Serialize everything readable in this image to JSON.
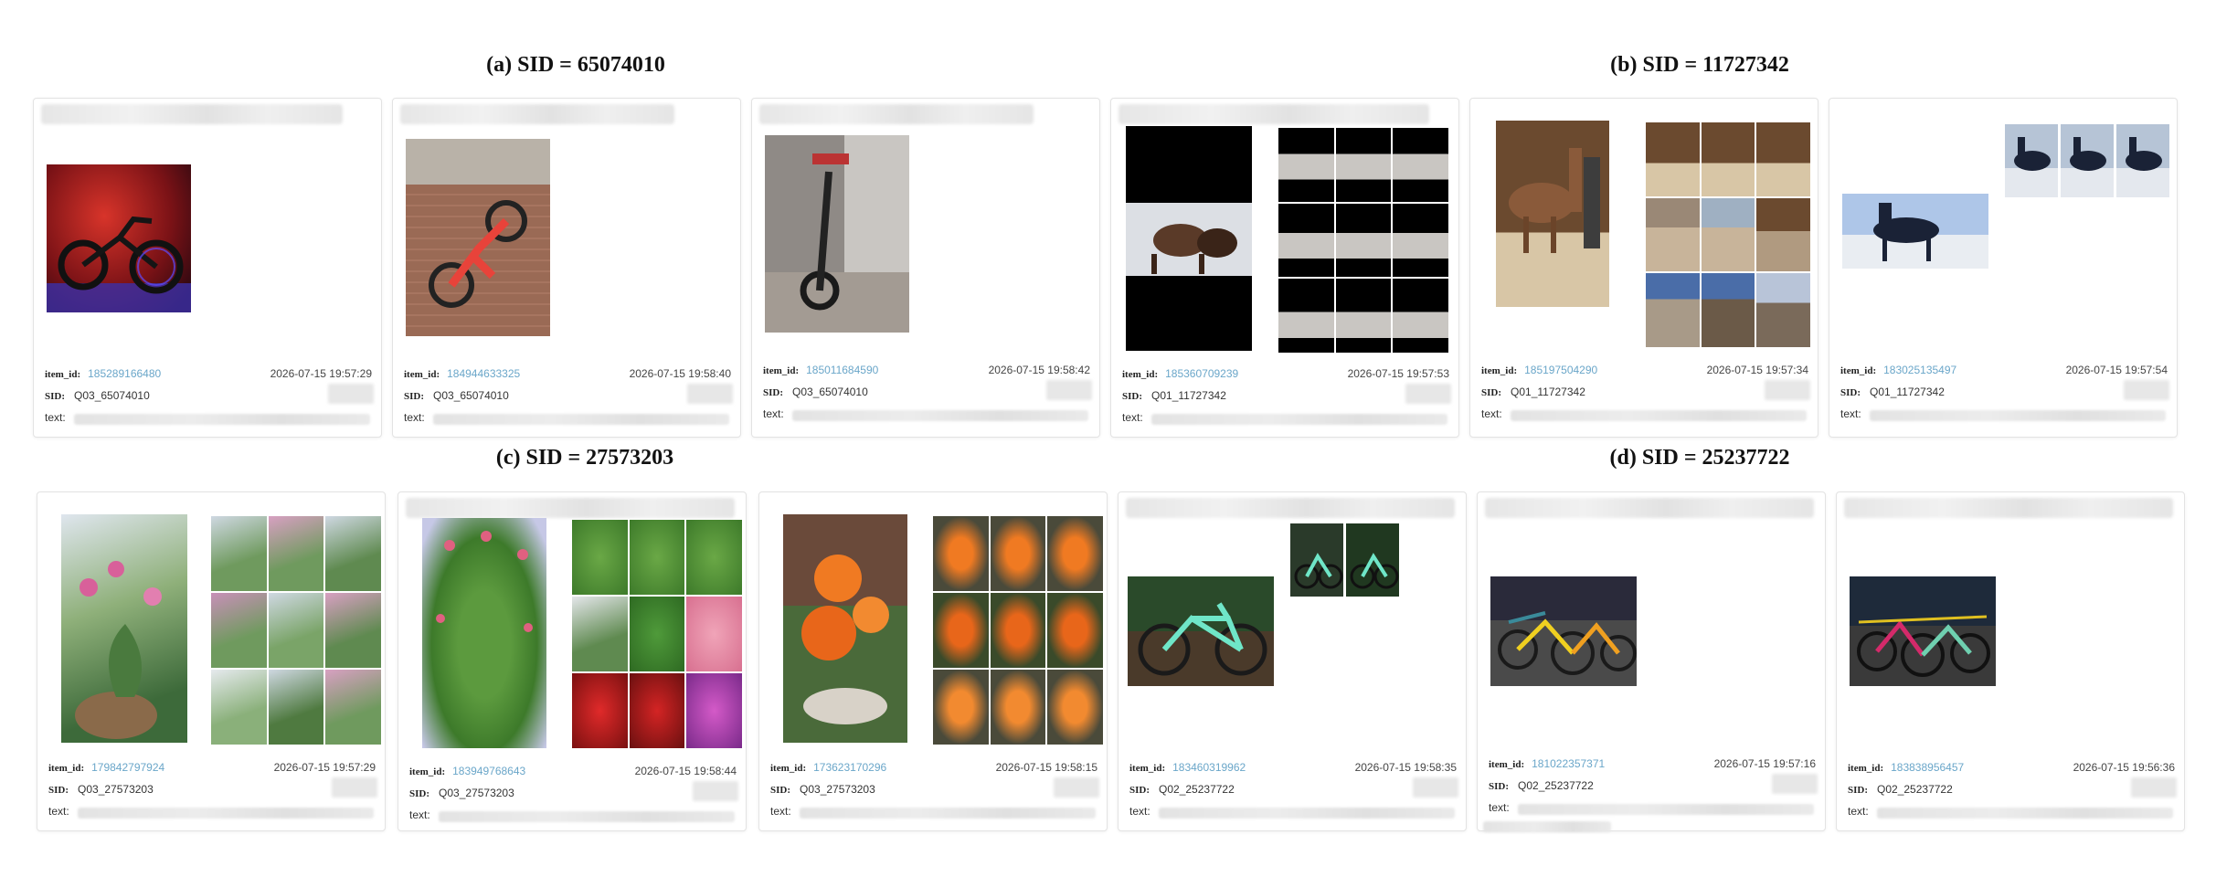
{
  "captions": {
    "a": "(a) SID = 65074010",
    "b": "(b) SID = 11727342",
    "c": "(c) SID = 27573203",
    "d": "(d) SID = 25237722"
  },
  "labels": {
    "item_id": "item_id:",
    "sid": "SID:",
    "text": "text:"
  },
  "cards": [
    {
      "item_id": "185289166480",
      "timestamp": "2026-07-15 19:57:29",
      "sid": "Q03_65074010"
    },
    {
      "item_id": "184944633325",
      "timestamp": "2026-07-15 19:58:40",
      "sid": "Q03_65074010"
    },
    {
      "item_id": "185011684590",
      "timestamp": "2026-07-15 19:58:42",
      "sid": "Q03_65074010"
    },
    {
      "item_id": "185360709239",
      "timestamp": "2026-07-15 19:57:53",
      "sid": "Q01_11727342"
    },
    {
      "item_id": "185197504290",
      "timestamp": "2026-07-15 19:57:34",
      "sid": "Q01_11727342"
    },
    {
      "item_id": "183025135497",
      "timestamp": "2026-07-15 19:57:54",
      "sid": "Q01_11727342"
    },
    {
      "item_id": "179842797924",
      "timestamp": "2026-07-15 19:57:29",
      "sid": "Q03_27573203"
    },
    {
      "item_id": "183949768643",
      "timestamp": "2026-07-15 19:58:44",
      "sid": "Q03_27573203"
    },
    {
      "item_id": "173623170296",
      "timestamp": "2026-07-15 19:58:15",
      "sid": "Q03_27573203"
    },
    {
      "item_id": "183460319962",
      "timestamp": "2026-07-15 19:58:35",
      "sid": "Q02_25237722"
    },
    {
      "item_id": "181022357371",
      "timestamp": "2026-07-15 19:57:16",
      "sid": "Q02_25237722"
    },
    {
      "item_id": "183838956457",
      "timestamp": "2026-07-15 19:56:36",
      "sid": "Q02_25237722"
    }
  ],
  "colors": {
    "item_id_link": "#6aa6c9"
  }
}
